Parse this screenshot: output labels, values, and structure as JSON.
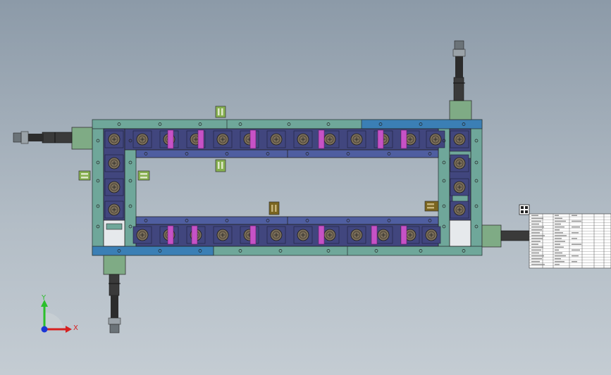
{
  "triad": {
    "x_label": "X",
    "y_label": "Y"
  },
  "colors": {
    "frame": "#6fa79a",
    "frame_dark": "#3f6f68",
    "rail": "#4f5ea0",
    "rail_blue": "#3b7fb5",
    "block": "#41467e",
    "roller": "#7a6e5a",
    "pink": "#c652c6",
    "cyl_body": "#3a3a3a",
    "cyl_fitting": "#9aa2a8",
    "clip_green": "#86b050",
    "clip_brown": "#7a6520",
    "mount": "#7fab85",
    "axis_x": "#d62020",
    "axis_y": "#2bbf2b",
    "axis_z": "#1a35d6"
  },
  "title_block": {
    "visible": true
  },
  "move_icon": "move-handle-icon"
}
